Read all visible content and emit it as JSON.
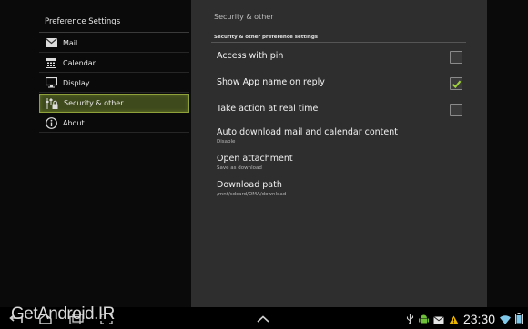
{
  "left": {
    "title": "Preference Settings",
    "items": [
      {
        "label": "Mail",
        "icon": "mail-icon"
      },
      {
        "label": "Calendar",
        "icon": "calendar-icon"
      },
      {
        "label": "Display",
        "icon": "display-icon"
      },
      {
        "label": "Security & other",
        "icon": "security-icon",
        "selected": true
      },
      {
        "label": "About",
        "icon": "info-icon"
      }
    ]
  },
  "right": {
    "title": "Security & other",
    "section_header": "Security & other preference settings",
    "rows": [
      {
        "title": "Access with pin",
        "checked": false
      },
      {
        "title": "Show App name on reply",
        "checked": true
      },
      {
        "title": "Take action at real time",
        "checked": false
      },
      {
        "title": "Auto download mail and calendar content",
        "subtitle": "Disable"
      },
      {
        "title": "Open attachment",
        "subtitle": "Save as download"
      },
      {
        "title": "Download path",
        "subtitle": "/mnt/sdcard/OMA/download"
      }
    ]
  },
  "navbar": {
    "watermark": "GetAndroid.IR",
    "clock": "23:30",
    "icons": [
      "back-icon",
      "home-icon",
      "recent-apps-icon",
      "screenshot-icon",
      "up-chevron-icon",
      "usb-icon",
      "android-icon",
      "mail-notification-icon",
      "warning-icon",
      "wifi-icon",
      "battery-icon"
    ]
  },
  "colors": {
    "accent": "#8ea13b",
    "check": "#9fd13a",
    "pane": "#2e2e2e"
  }
}
